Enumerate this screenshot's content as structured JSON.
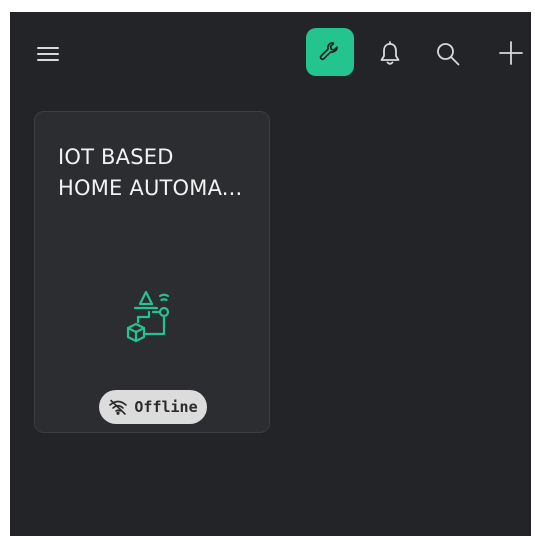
{
  "header": {
    "icons": [
      "menu-icon",
      "wrench-icon",
      "bell-icon",
      "search-icon",
      "plus-icon"
    ],
    "accent_color": "#23c48e"
  },
  "devices": [
    {
      "title": "IOT BASED\nHOME AUTOMA...",
      "status": "Offline",
      "icon": "iot-devices-icon",
      "status_icon": "wifi-off-icon"
    }
  ],
  "colors": {
    "background": "#232427",
    "card": "#2c2d31",
    "status_pill": "#dcdcdc"
  }
}
